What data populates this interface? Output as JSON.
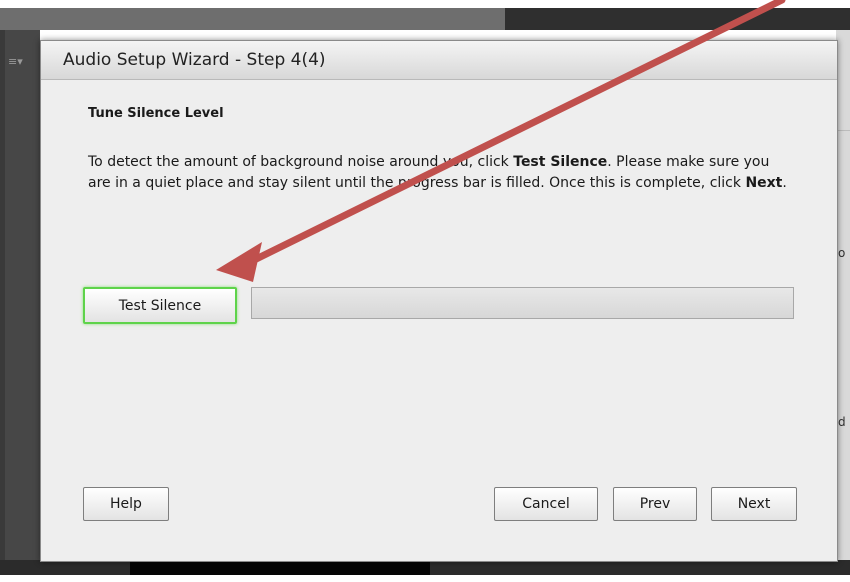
{
  "background": {
    "menu_glyph": "≡▾",
    "right_text_1": "o",
    "right_text_2": "d"
  },
  "dialog": {
    "title": "Audio Setup Wizard - Step 4(4)",
    "heading": "Tune Silence Level",
    "instructions": {
      "part1": "To detect the amount of background noise around you, click ",
      "bold1": "Test Silence",
      "part2": ". Please make sure you are in a quiet place and stay silent until the progress bar is filled. Once this is complete, click ",
      "bold2": "Next",
      "part3": "."
    },
    "test_button_label": "Test Silence",
    "progress_fraction": 0,
    "buttons": {
      "help": "Help",
      "cancel": "Cancel",
      "prev": "Prev",
      "next": "Next"
    }
  },
  "colors": {
    "arrow": "#c0504d",
    "focus_green": "#5ed34a"
  },
  "icons": {
    "annotation": "arrow-icon"
  }
}
